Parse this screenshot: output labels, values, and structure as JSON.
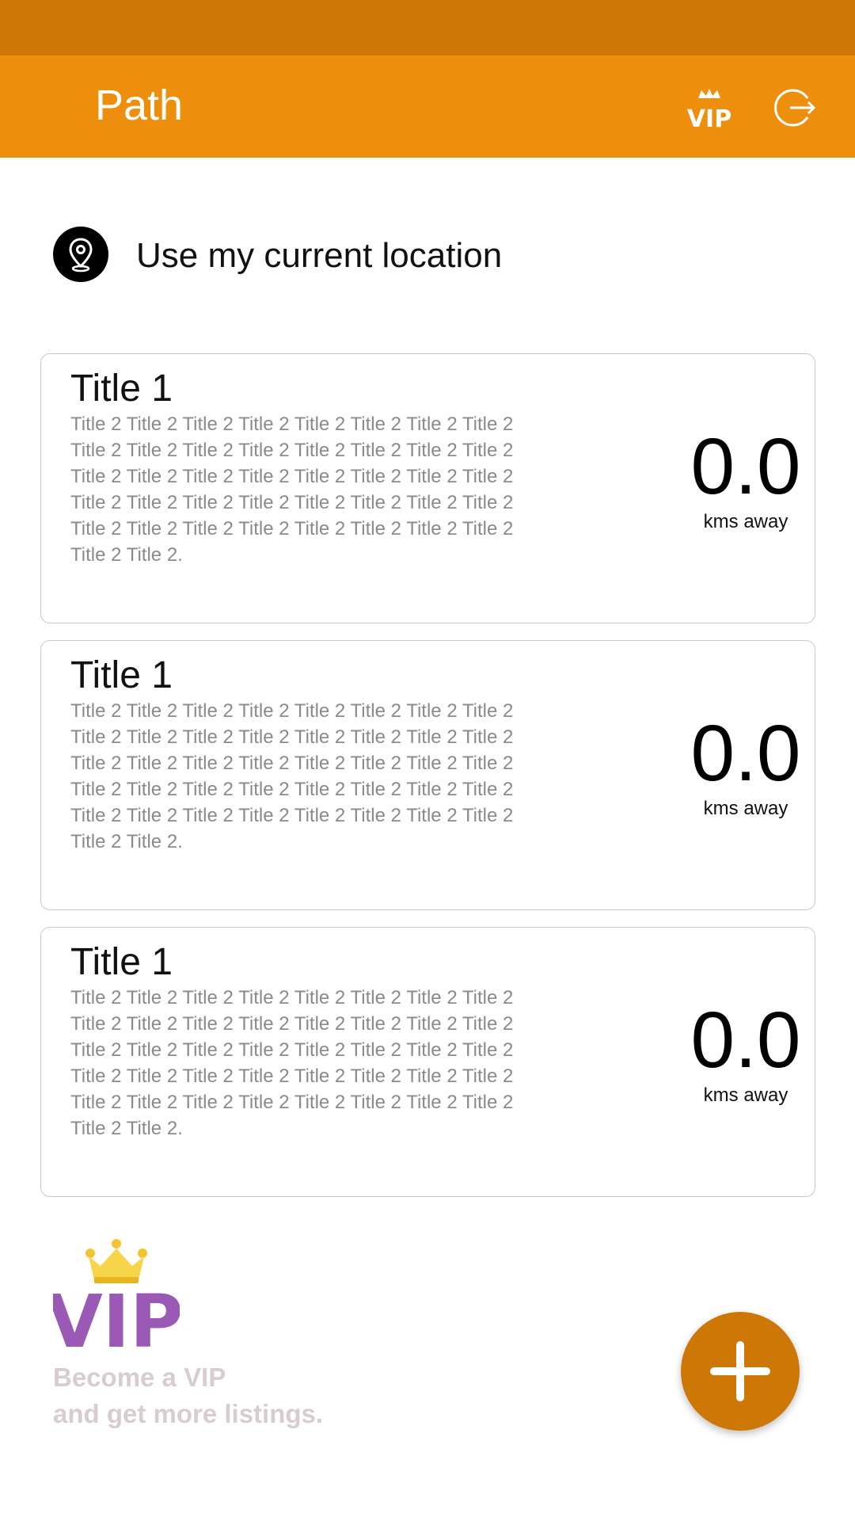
{
  "app": {
    "title": "Path"
  },
  "actions": {
    "vip_icon": "vip-crown-icon",
    "logout_icon": "logout-icon"
  },
  "location": {
    "label": "Use my current location",
    "icon": "location-pin-icon"
  },
  "listings": [
    {
      "title": "Title 1",
      "description": "Title 2 Title 2 Title 2 Title 2 Title 2 Title 2 Title 2 Title 2 Title 2 Title 2 Title 2 Title 2 Title 2 Title 2 Title 2 Title 2 Title 2 Title 2 Title 2 Title 2 Title 2 Title 2 Title 2 Title 2 Title 2 Title 2 Title 2 Title 2 Title 2 Title 2 Title 2 Title 2 Title 2 Title 2 Title 2 Title 2 Title 2 Title 2 Title 2 Title 2 Title 2 Title 2.",
      "distance": "0.0",
      "unit": "kms away"
    },
    {
      "title": "Title 1",
      "description": "Title 2 Title 2 Title 2 Title 2 Title 2 Title 2 Title 2 Title 2 Title 2 Title 2 Title 2 Title 2 Title 2 Title 2 Title 2 Title 2 Title 2 Title 2 Title 2 Title 2 Title 2 Title 2 Title 2 Title 2 Title 2 Title 2 Title 2 Title 2 Title 2 Title 2 Title 2 Title 2 Title 2 Title 2 Title 2 Title 2 Title 2 Title 2 Title 2 Title 2 Title 2 Title 2.",
      "distance": "0.0",
      "unit": "kms away"
    },
    {
      "title": "Title 1",
      "description": "Title 2 Title 2 Title 2 Title 2 Title 2 Title 2 Title 2 Title 2 Title 2 Title 2 Title 2 Title 2 Title 2 Title 2 Title 2 Title 2 Title 2 Title 2 Title 2 Title 2 Title 2 Title 2 Title 2 Title 2 Title 2 Title 2 Title 2 Title 2 Title 2 Title 2 Title 2 Title 2 Title 2 Title 2 Title 2 Title 2 Title 2 Title 2 Title 2 Title 2 Title 2 Title 2.",
      "distance": "0.0",
      "unit": "kms away"
    }
  ],
  "promo": {
    "logo_text": "VIP",
    "line1": "Become a VIP",
    "line2": "and get more listings."
  },
  "fab": {
    "icon": "plus-icon"
  },
  "colors": {
    "status_bar": "#cc7706",
    "app_bar": "#ed8e0d",
    "fab": "#cc7706",
    "vip_purple": "#9b59b6",
    "vip_crown": "#f4c430",
    "promo_text": "#d8ccd0"
  }
}
